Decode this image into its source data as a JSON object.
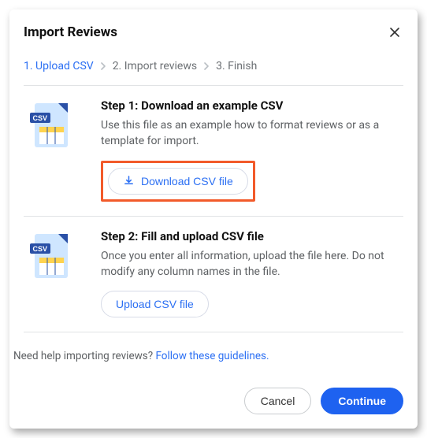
{
  "header": {
    "title": "Import Reviews"
  },
  "steps": {
    "s1": "1.  Upload CSV",
    "s2": "2.  Import reviews",
    "s3": "3.  Finish"
  },
  "section1": {
    "title": "Step 1: Download an example CSV",
    "desc": "Use this file as an example how to format reviews or as a template for import.",
    "button": "Download CSV file"
  },
  "section2": {
    "title": "Step 2: Fill and upload CSV file",
    "desc": "Once you enter all information, upload the file here. Do not modify any column names in the file.",
    "button": "Upload CSV file"
  },
  "help": {
    "text": "Need help importing reviews? ",
    "link": "Follow these guidelines."
  },
  "footer": {
    "cancel": "Cancel",
    "continue": "Continue"
  }
}
